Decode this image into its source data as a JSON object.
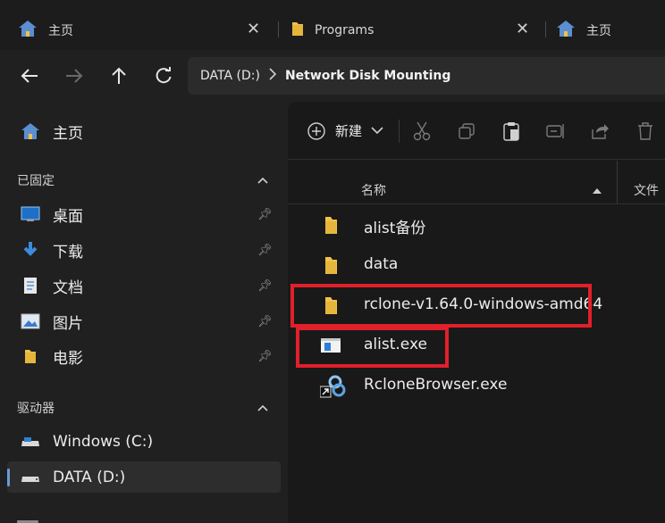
{
  "tabs": [
    {
      "label": "主页"
    },
    {
      "label": "Programs"
    },
    {
      "label": "主页"
    }
  ],
  "address": {
    "segments": [
      "DATA (D:)"
    ],
    "current": "Network Disk Mounting"
  },
  "sidebar": {
    "home": {
      "label": "主页"
    },
    "pinned_section": "已固定",
    "pinned": [
      {
        "label": "桌面",
        "icon": "desktop-icon"
      },
      {
        "label": "下载",
        "icon": "download-icon"
      },
      {
        "label": "文档",
        "icon": "document-icon"
      },
      {
        "label": "图片",
        "icon": "pictures-icon"
      },
      {
        "label": "电影",
        "icon": "folder-icon"
      }
    ],
    "drives_section": "驱动器",
    "drives": [
      {
        "label": "Windows (C:)",
        "icon": "drive-icon"
      },
      {
        "label": "DATA (D:)",
        "icon": "drive-icon",
        "selected": true
      }
    ]
  },
  "toolbar": {
    "new_label": "新建"
  },
  "columns": {
    "name": "名称",
    "type_partial": "文件"
  },
  "files": [
    {
      "name": "alist备份",
      "icon": "folder-icon"
    },
    {
      "name": "data",
      "icon": "folder-icon"
    },
    {
      "name": "rclone-v1.64.0-windows-amd64",
      "icon": "folder-icon",
      "highlighted": true
    },
    {
      "name": "alist.exe",
      "icon": "exe-icon",
      "highlighted": true
    },
    {
      "name": "RcloneBrowser.exe",
      "icon": "shortcut-icon"
    }
  ],
  "colors": {
    "highlight": "#e0202a",
    "folder": "#f0c24a",
    "accent": "#6b9bd6"
  }
}
